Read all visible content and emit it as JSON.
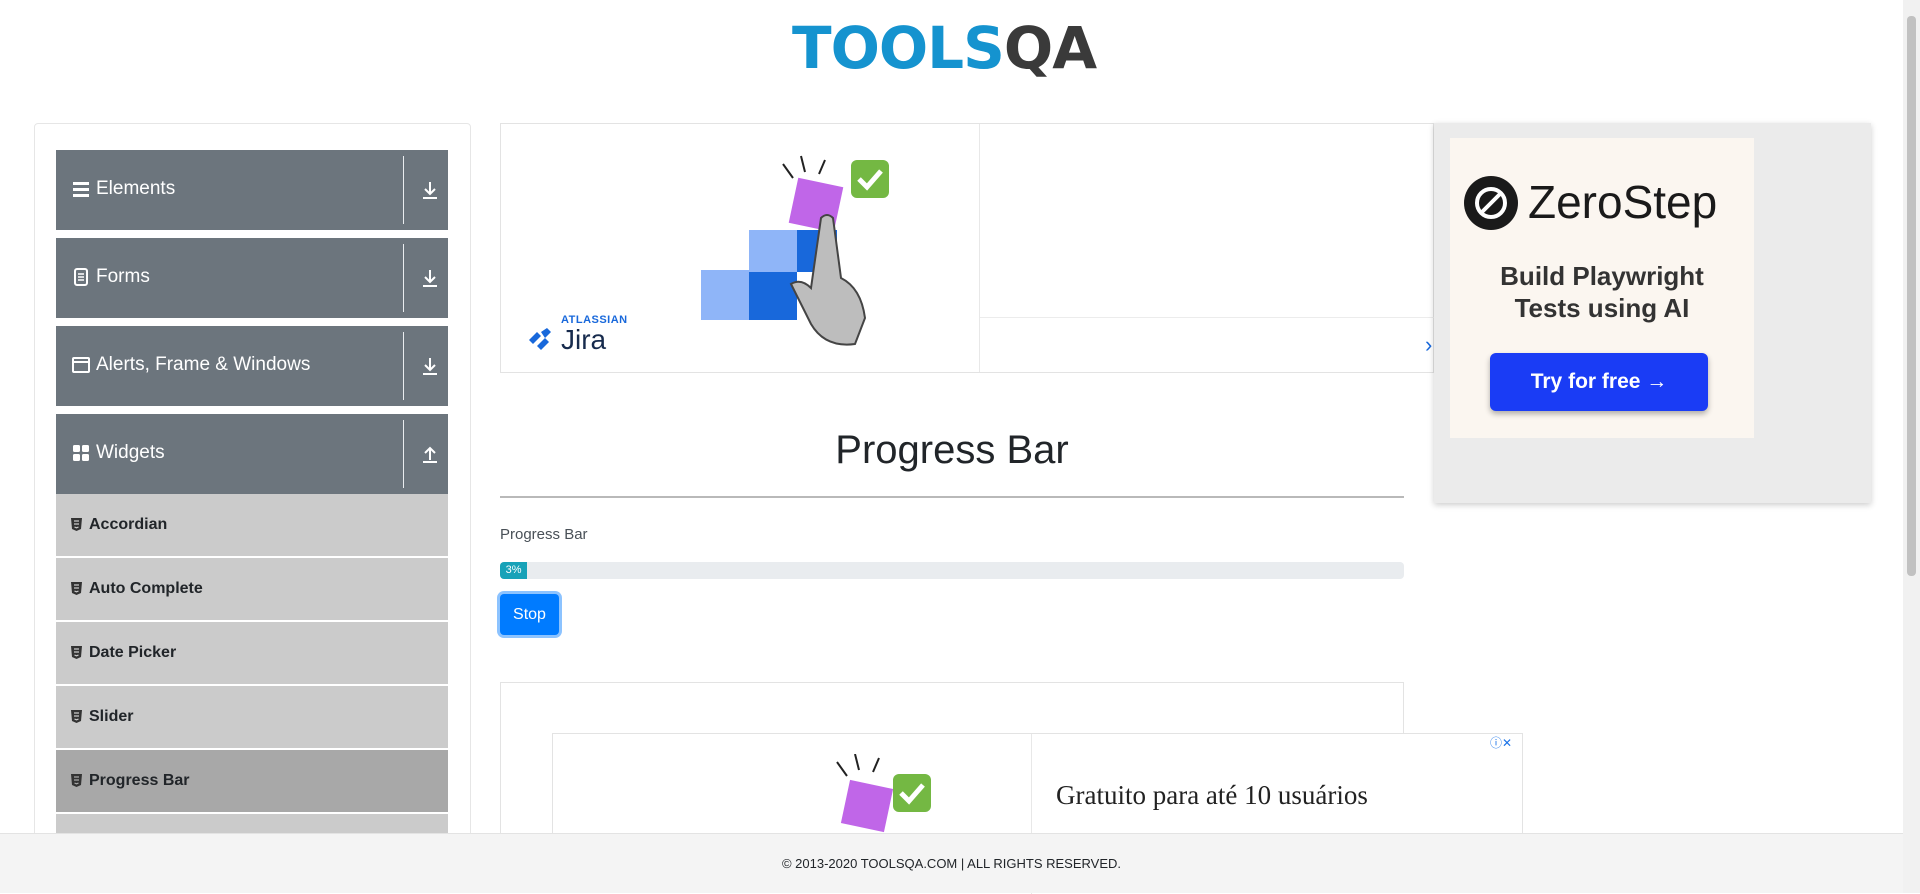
{
  "logo": {
    "tools": "TOOLS",
    "qa": "QA"
  },
  "sidebar": {
    "groups": [
      {
        "label": "Elements",
        "icon": "bars-icon",
        "expanded": false
      },
      {
        "label": "Forms",
        "icon": "document-icon",
        "expanded": false
      },
      {
        "label": "Alerts, Frame & Windows",
        "icon": "window-icon",
        "expanded": false
      },
      {
        "label": "Widgets",
        "icon": "grid-icon",
        "expanded": true
      }
    ],
    "items": [
      {
        "label": "Accordian"
      },
      {
        "label": "Auto Complete"
      },
      {
        "label": "Date Picker"
      },
      {
        "label": "Slider"
      },
      {
        "label": "Progress Bar",
        "active": true
      }
    ]
  },
  "ads": {
    "top": {
      "brand_small": "ATLASSIAN",
      "brand": "Jira"
    },
    "right": {
      "brand": "ZeroStep",
      "tagline": "Build Playwright\nTests using AI",
      "cta": "Try for free →"
    },
    "bottom": {
      "text": "Gratuito para até 10 usuários"
    }
  },
  "main": {
    "title": "Progress Bar",
    "progress_label": "Progress Bar",
    "progress_value": 3,
    "progress_text": "3%",
    "stop_label": "Stop"
  },
  "footer": {
    "text": "© 2013-2020 TOOLSQA.COM | ALL RIGHTS RESERVED."
  },
  "colors": {
    "accent": "#1593cf",
    "sidebar_header": "#6c757d",
    "progress": "#17a2b8",
    "button": "#007bff"
  }
}
